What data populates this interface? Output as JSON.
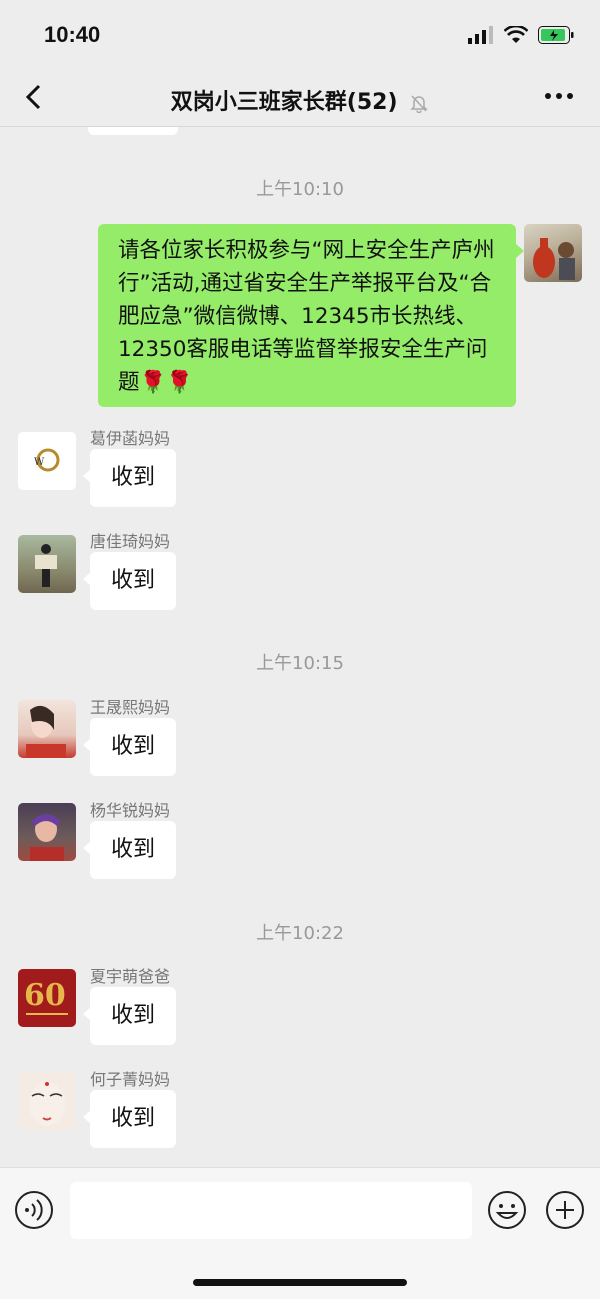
{
  "status": {
    "time": "10:40"
  },
  "header": {
    "title": "双岗小三班家长群(52)"
  },
  "icons": {
    "back": "chevron-left-icon",
    "mute": "bell-slash-icon",
    "more": "more-dots-icon",
    "voice": "voice-icon",
    "emoji": "emoji-icon",
    "plus": "plus-icon"
  },
  "timestamps": [
    "上午10:10",
    "上午10:15",
    "上午10:22"
  ],
  "outgoing": {
    "text": "请各位家长积极参与“网上安全生产庐州行”活动,通过省安全生产举报平台及“合肥应急”微信微博、12345市长热线、12350客服电话等监督举报安全生产问题🌹🌹"
  },
  "messages": [
    {
      "sender": "葛伊菡妈妈",
      "text": "收到"
    },
    {
      "sender": "唐佳琦妈妈",
      "text": "收到"
    },
    {
      "sender": "王晟熙妈妈",
      "text": "收到"
    },
    {
      "sender": "杨华锐妈妈",
      "text": "收到"
    },
    {
      "sender": "夏宇萌爸爸",
      "text": "收到"
    },
    {
      "sender": "何子菁妈妈",
      "text": "收到"
    }
  ],
  "colors": {
    "outgoing_bubble": "#95ec69",
    "background": "#ededed",
    "battery": "#34c759"
  }
}
